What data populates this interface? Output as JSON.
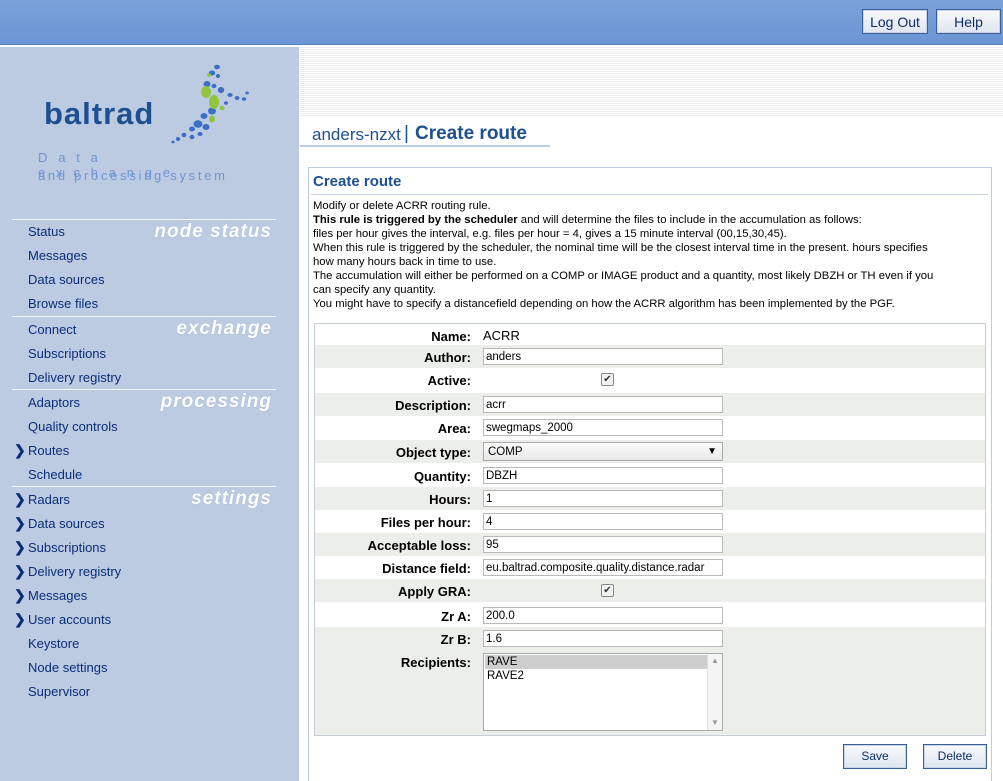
{
  "header": {
    "logout_label": "Log Out",
    "help_label": "Help"
  },
  "brand": {
    "name": "baltrad",
    "tagline_1": "Data exchange",
    "tagline_2": "and processing system"
  },
  "nav": {
    "sections": [
      {
        "title": "node status",
        "items": [
          {
            "label": "Status",
            "expandable": false
          },
          {
            "label": "Messages",
            "expandable": false
          },
          {
            "label": "Data sources",
            "expandable": false
          },
          {
            "label": "Browse files",
            "expandable": false
          }
        ]
      },
      {
        "title": "exchange",
        "items": [
          {
            "label": "Connect",
            "expandable": false
          },
          {
            "label": "Subscriptions",
            "expandable": false
          },
          {
            "label": "Delivery registry",
            "expandable": false
          }
        ]
      },
      {
        "title": "processing",
        "items": [
          {
            "label": "Adaptors",
            "expandable": false
          },
          {
            "label": "Quality controls",
            "expandable": false
          },
          {
            "label": "Routes",
            "expandable": true
          },
          {
            "label": "Schedule",
            "expandable": false
          }
        ]
      },
      {
        "title": "settings",
        "items": [
          {
            "label": "Radars",
            "expandable": true
          },
          {
            "label": "Data sources",
            "expandable": true
          },
          {
            "label": "Subscriptions",
            "expandable": true
          },
          {
            "label": "Delivery registry",
            "expandable": true
          },
          {
            "label": "Messages",
            "expandable": true
          },
          {
            "label": "User accounts",
            "expandable": true
          },
          {
            "label": "Keystore",
            "expandable": false
          },
          {
            "label": "Node settings",
            "expandable": false
          },
          {
            "label": "Supervisor",
            "expandable": false
          }
        ]
      }
    ]
  },
  "page": {
    "host": "anders-nzxt",
    "separator": "|",
    "title": "Create route"
  },
  "panel": {
    "title": "Create route",
    "desc_line1": "Modify or delete ACRR routing rule.",
    "desc_line2_bold": "This rule is triggered by the scheduler",
    "desc_line2_rest": " and will determine the files to include in the accumulation as follows:",
    "desc_line3": "files per hour gives the interval, e.g. files per hour = 4, gives a 15 minute interval (00,15,30,45).",
    "desc_line4": "When this rule is triggered by the scheduler, the nominal time will be the closest interval time in the present. hours specifies",
    "desc_line5": "how many hours back in time to use.",
    "desc_line6": "The accumulation will either be performed on a COMP or IMAGE product and a quantity, most likely DBZH or TH even if you",
    "desc_line7": "can specify any quantity.",
    "desc_line8": "You might have to specify a distancefield depending on how the ACRR algorithm has been implemented by the PGF."
  },
  "form": {
    "name": {
      "label": "Name:",
      "value": "ACRR"
    },
    "author": {
      "label": "Author:",
      "value": "anders"
    },
    "active": {
      "label": "Active:",
      "checked": true,
      "mark": "✔"
    },
    "description": {
      "label": "Description:",
      "value": "acrr"
    },
    "area": {
      "label": "Area:",
      "value": "swegmaps_2000"
    },
    "object_type": {
      "label": "Object type:",
      "value": "COMP",
      "arrow": "▼"
    },
    "quantity": {
      "label": "Quantity:",
      "value": "DBZH"
    },
    "hours": {
      "label": "Hours:",
      "value": "1"
    },
    "files_per_hour": {
      "label": "Files per hour:",
      "value": "4"
    },
    "acceptable_loss": {
      "label": "Acceptable loss:",
      "value": "95"
    },
    "distance_field": {
      "label": "Distance field:",
      "value": "eu.baltrad.composite.quality.distance.radar"
    },
    "apply_gra": {
      "label": "Apply GRA:",
      "checked": true,
      "mark": "✔"
    },
    "zr_a": {
      "label": "Zr A:",
      "value": "200.0"
    },
    "zr_b": {
      "label": "Zr B:",
      "value": "1.6"
    },
    "recipients": {
      "label": "Recipients:",
      "options": [
        "RAVE",
        "RAVE2"
      ],
      "selected": "RAVE",
      "scroll_up": "▲",
      "scroll_down": "▼"
    }
  },
  "actions": {
    "save_label": "Save",
    "delete_label": "Delete"
  },
  "icons": {
    "chevron": "❯"
  },
  "colors": {
    "accent": "#1e4f91",
    "sidebar": "#bccbe2",
    "topbar": "#6c95d3"
  }
}
